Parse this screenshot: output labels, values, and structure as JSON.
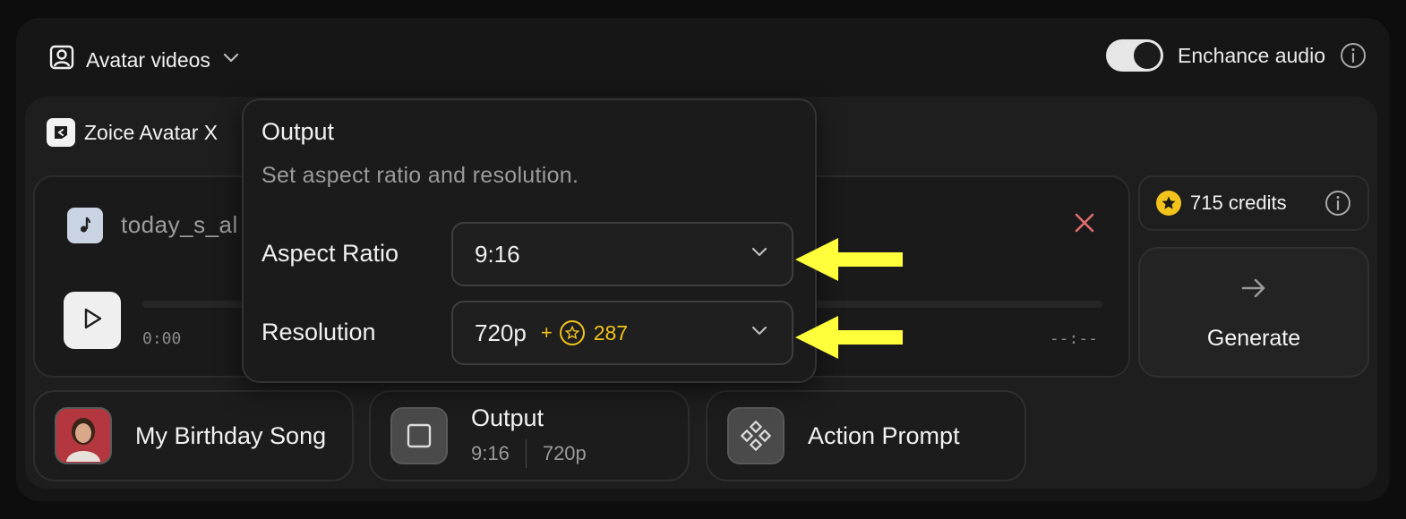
{
  "topbar": {
    "mode_label": "Avatar videos",
    "enhance_label": "Enchance audio",
    "enhance_on": true
  },
  "model": {
    "name": "Zoice Avatar X"
  },
  "audio": {
    "filename": "today_s_al",
    "time_current": "0:00",
    "time_total": "--:--"
  },
  "credits": {
    "label": "715 credits"
  },
  "generate": {
    "label": "Generate"
  },
  "chips": {
    "song": {
      "title": "My Birthday Song"
    },
    "output": {
      "title": "Output",
      "aspect": "9:16",
      "resolution": "720p"
    },
    "action": {
      "title": "Action Prompt"
    }
  },
  "popover": {
    "title": "Output",
    "subtitle": "Set aspect ratio and resolution.",
    "aspect_label": "Aspect Ratio",
    "aspect_value": "9:16",
    "resolution_label": "Resolution",
    "resolution_value": "720p",
    "resolution_plus": "+",
    "resolution_cost": "287"
  },
  "colors": {
    "accent_yellow": "#f3c21b",
    "annotation_yellow": "#ffff3c",
    "close_red": "#e06c6c"
  }
}
